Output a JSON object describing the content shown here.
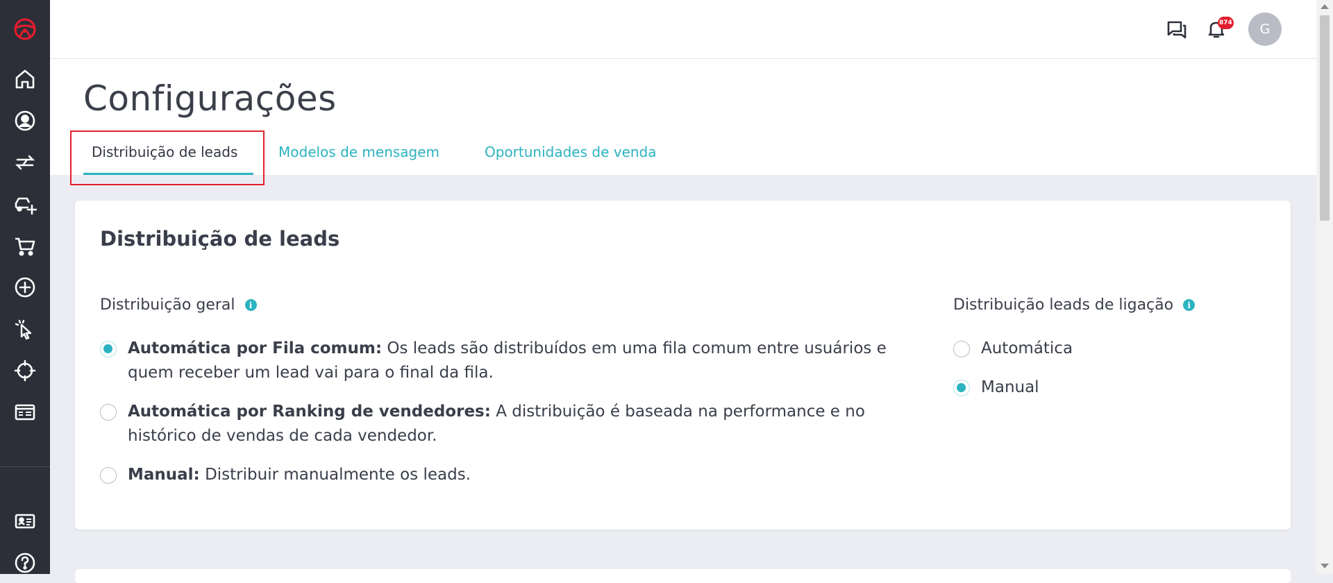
{
  "header": {
    "notification_count": "874",
    "avatar_initial": "G"
  },
  "page": {
    "title": "Configurações"
  },
  "tabs": [
    {
      "label": "Distribuição de leads",
      "active": true
    },
    {
      "label": "Modelos de mensagem",
      "active": false
    },
    {
      "label": "Oportunidades de venda",
      "active": false
    }
  ],
  "card": {
    "title": "Distribuição de leads",
    "general": {
      "label": "Distribuição geral",
      "options": [
        {
          "bold": "Automática por Fila comum:",
          "text": " Os leads são distribuídos em uma fila comum entre usuários e",
          "text2": "quem receber um lead vai para o final da fila.",
          "checked": true
        },
        {
          "bold": "Automática por Ranking de vendedores:",
          "text": " A distribuição é baseada na performance e no",
          "text2": "histórico de vendas de cada vendedor.",
          "checked": false
        },
        {
          "bold": "Manual:",
          "text": " Distribuir manualmente os leads.",
          "checked": false
        }
      ]
    },
    "calls": {
      "label": "Distribuição leads de ligação",
      "options": [
        {
          "text": "Automática",
          "checked": false
        },
        {
          "text": "Manual",
          "checked": true
        }
      ]
    }
  },
  "colors": {
    "accent": "#2bb3c0",
    "sidebar": "#2c2f38",
    "brand": "#e11d2e",
    "highlight": "#e0202a"
  },
  "icons": [
    "steering-wheel-logo-icon",
    "home-icon",
    "user-circle-icon",
    "transfer-arrows-icon",
    "car-add-icon",
    "cart-icon",
    "plus-circle-icon",
    "pointer-click-icon",
    "crosshair-icon",
    "browser-window-icon",
    "id-card-icon",
    "help-icon",
    "chat-icon",
    "bell-icon"
  ]
}
